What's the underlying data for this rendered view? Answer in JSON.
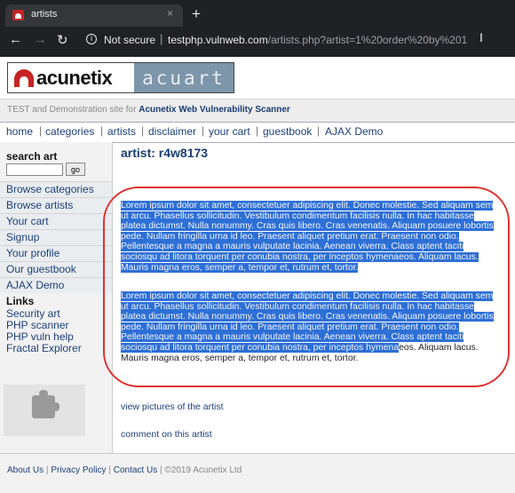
{
  "browser": {
    "tab_title": "artists",
    "tab_close": "×",
    "new_tab": "+",
    "back": "←",
    "forward": "→",
    "reload": "↻",
    "info": "i",
    "not_secure": "Not secure",
    "separator": "|",
    "url_host": "testphp.vulnweb.com",
    "url_rest": "/artists.php?artist=1%20order%20by%201",
    "cursor": "I"
  },
  "site": {
    "logo_left": "acunetix",
    "logo_right": "acuart",
    "subheader_prefix": "TEST and Demonstration site for ",
    "subheader_link": "Acunetix Web Vulnerability Scanner",
    "topnav": [
      "home",
      "categories",
      "artists",
      "disclaimer",
      "your cart",
      "guestbook",
      "AJAX Demo"
    ]
  },
  "sidebar": {
    "search_heading": "search art",
    "search_value": "",
    "go_label": "go",
    "menu": [
      "Browse categories",
      "Browse artists",
      "Your cart",
      "Signup",
      "Your profile",
      "Our guestbook",
      "AJAX Demo"
    ],
    "links_heading": "Links",
    "links": [
      "Security art",
      "PHP scanner",
      "PHP vuln help",
      "Fractal Explorer"
    ]
  },
  "main": {
    "title": "artist: r4w8173",
    "para1": "Lorem ipsum dolor sit amet, consectetuer adipiscing elit. Donec molestie. Sed aliquam sem ut arcu. Phasellus sollicitudin. Vestibulum condimentum facilisis nulla. In hac habitasse platea dictumst. Nulla nonummy. Cras quis libero. Cras venenatis. Aliquam posuere lobortis pede. Nullam fringilla urna id leo. Praesent aliquet pretium erat. Praesent non odio. Pellentesque a magna a mauris vulputate lacinia. Aenean viverra. Class aptent taciti sociosqu ad litora torquent per conubia nostra, per inceptos hymenaeos. Aliquam lacus. Mauris magna eros, semper a, tempor et, rutrum et, tortor.",
    "para2_selected": "Lorem ipsum dolor sit amet, consectetuer adipiscing elit. Donec molestie. Sed aliquam sem ut arcu. Phasellus sollicitudin. Vestibulum condimentum facilisis nulla. In hac habitasse platea dictumst. Nulla nonummy. Cras quis libero. Cras venenatis. Aliquam posuere lobortis pede. Nullam fringilla urna id leo. Praesent aliquet pretium erat. Praesent non odio. Pellentesque a magna a mauris vulputate lacinia. Aenean viverra. Class aptent taciti sociosqu ad litora torquent per conubia nostra, per inceptos hymena",
    "para2_rest": "eos. Aliquam lacus. Mauris magna eros, semper a, tempor et, rutrum et, tortor.",
    "view_pictures": "view pictures of the artist",
    "comment": "comment on this artist"
  },
  "footer": {
    "about": "About Us",
    "privacy": "Privacy Policy",
    "contact": "Contact Us",
    "copyright": "©2019 Acunetix Ltd",
    "sep": "|"
  },
  "colors": {
    "selection": "#2d6fd6",
    "annotation_red": "#e03131",
    "link": "#1e3f78"
  }
}
